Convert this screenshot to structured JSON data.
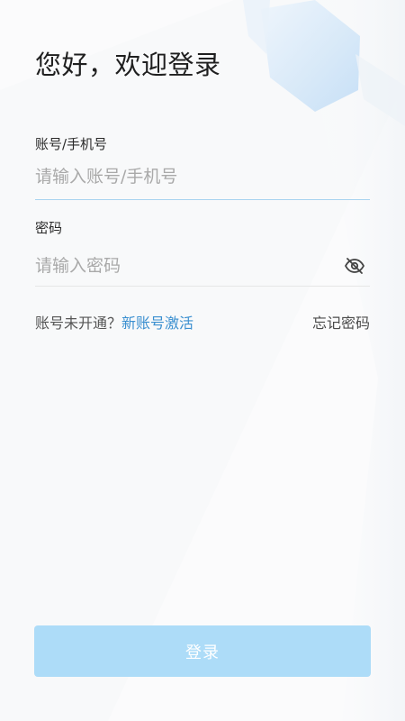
{
  "header": {
    "title": "您好，欢迎登录"
  },
  "account": {
    "label": "账号/手机号",
    "placeholder": "请输入账号/手机号",
    "value": ""
  },
  "password": {
    "label": "密码",
    "placeholder": "请输入密码",
    "value": "",
    "visibility_icon": "eye-off-icon"
  },
  "links": {
    "not_activated_text": "账号未开通？",
    "activate_link": "新账号激活",
    "forgot_password": "忘记密码"
  },
  "login_button": {
    "label": "登录"
  },
  "colors": {
    "accent": "#3a8fd0",
    "button_disabled": "#addcf8",
    "active_underline": "#a8d3ef",
    "background": "#fbfbfc"
  }
}
